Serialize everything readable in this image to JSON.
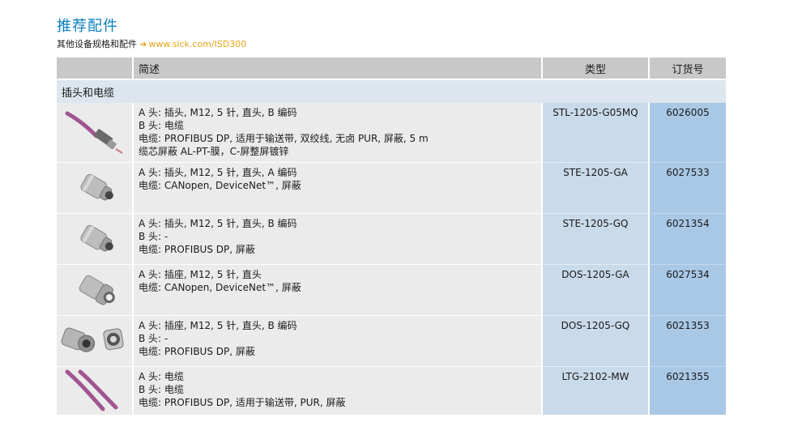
{
  "page": {
    "title": "推荐配件",
    "subtitle": "其他设备规格和配件",
    "arrow": "➜",
    "link": "www.sick.com/ISD300"
  },
  "table": {
    "headers": {
      "description": "简述",
      "type": "类型",
      "order": "订货号"
    },
    "section": "插头和电缆",
    "rows": [
      {
        "image": "purple-cable-with-m12-connector",
        "lines": [
          "A 头: 插头, M12, 5 针, 直头, B 编码",
          "B 头: 电缆",
          "电缆: PROFIBUS DP, 适用于输送带, 双绞线, 无卤 PUR, 屏蔽, 5 m",
          "缆芯屏蔽 AL-PT-膜，C-屏整屏镀锌"
        ],
        "type": "STL-1205-G05MQ",
        "order": "6026005"
      },
      {
        "image": "m12-male-connector",
        "lines": [
          "A 头: 插头, M12, 5 针, 直头, A 编码",
          "电缆: CANopen, DeviceNet™, 屏蔽"
        ],
        "type": "STE-1205-GA",
        "order": "6027533"
      },
      {
        "image": "m12-male-connector",
        "lines": [
          "A 头: 插头, M12, 5 针, 直头, B 编码",
          "B 头: -",
          "电缆: PROFIBUS DP, 屏蔽"
        ],
        "type": "STE-1205-GQ",
        "order": "6021354"
      },
      {
        "image": "m12-female-connector",
        "lines": [
          "A 头: 插座, M12, 5 针, 直头",
          "电缆: CANopen, DeviceNet™, 屏蔽"
        ],
        "type": "DOS-1205-GA",
        "order": "6027534"
      },
      {
        "image": "m12-female-connector-pair",
        "lines": [
          "A 头: 插座, M12, 5 针, 直头, B 编码",
          "B 头: -",
          "电缆: PROFIBUS DP, 屏蔽"
        ],
        "type": "DOS-1205-GQ",
        "order": "6021353"
      },
      {
        "image": "purple-cable-pair",
        "lines": [
          "A 头: 电缆",
          "B 头: 电缆",
          "电缆: PROFIBUS DP, 适用于输送带, PUR, 屏蔽"
        ],
        "type": "LTG-2102-MW",
        "order": "6021355"
      }
    ]
  }
}
